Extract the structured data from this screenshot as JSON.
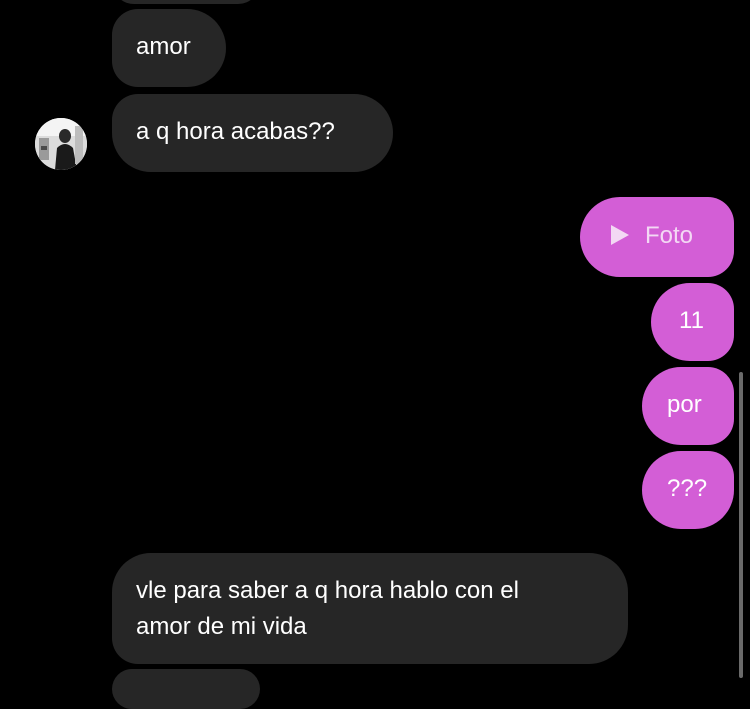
{
  "messages": [
    {
      "id": "m1",
      "direction": "incoming",
      "text": "amor"
    },
    {
      "id": "m2",
      "direction": "incoming",
      "text": "a q hora acabas??"
    },
    {
      "id": "m3",
      "direction": "outgoing",
      "type": "photo",
      "icon": "play-icon",
      "text": "Foto"
    },
    {
      "id": "m4",
      "direction": "outgoing",
      "text": "11"
    },
    {
      "id": "m5",
      "direction": "outgoing",
      "text": "por"
    },
    {
      "id": "m6",
      "direction": "outgoing",
      "text": "???"
    },
    {
      "id": "m7",
      "direction": "incoming",
      "lines": [
        "vle para saber a q hora hablo con el",
        "amor de mi vida"
      ]
    }
  ],
  "colors": {
    "background": "#000000",
    "incoming_bubble": "#262626",
    "outgoing_bubble": "#d35ed6",
    "text": "#ffffff"
  }
}
